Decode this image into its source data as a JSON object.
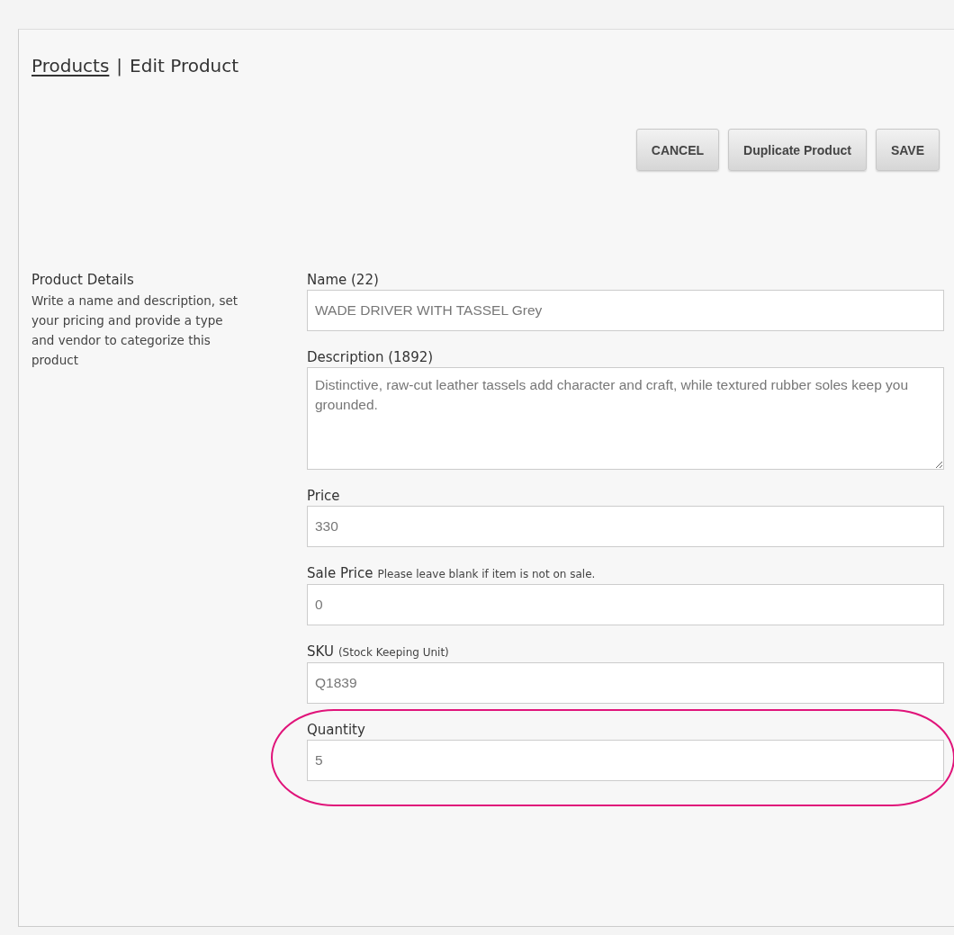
{
  "breadcrumb": {
    "link": "Products",
    "separator": "|",
    "current": "Edit Product"
  },
  "buttons": [
    {
      "label": "CANCEL"
    },
    {
      "label": "Duplicate Product"
    },
    {
      "label": "SAVE"
    }
  ],
  "section": {
    "title": "Product Details",
    "description": "Write a name and description, set your pricing and provide a type and vendor to categorize this product"
  },
  "fields": [
    {
      "kind": "input",
      "label": "Name (22)",
      "value": "WADE DRIVER WITH TASSEL Grey",
      "highlighted": false
    },
    {
      "kind": "textarea",
      "label": "Description (1892)",
      "value": "Distinctive, raw-cut leather tassels add character and craft, while textured rubber soles keep you grounded.",
      "highlighted": false
    },
    {
      "kind": "input",
      "label": "Price",
      "value": "330",
      "highlighted": false
    },
    {
      "kind": "input",
      "label": "Sale Price",
      "note": "Please leave blank if item is not on sale.",
      "value": "0",
      "highlighted": false
    },
    {
      "kind": "input",
      "label": "SKU",
      "note": "(Stock Keeping Unit)",
      "value": "Q1839",
      "highlighted": false
    },
    {
      "kind": "input",
      "label": "Quantity",
      "value": "5",
      "highlighted": true
    }
  ]
}
